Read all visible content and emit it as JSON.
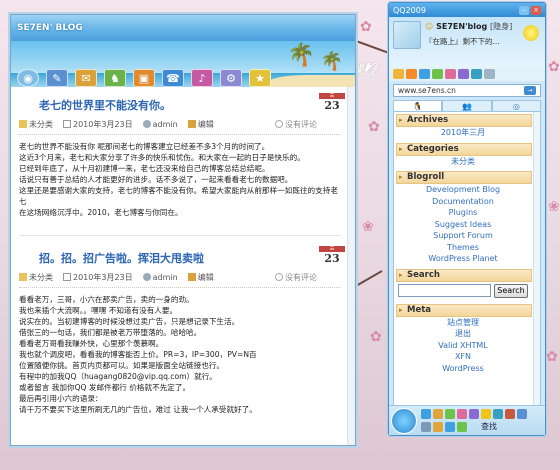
{
  "colors": {
    "blog_title_blue": "#2d66b3",
    "link_blue": "#2f6fbf",
    "qq_frame": "#4d8fc5",
    "widget_header": "#f2d59a",
    "date_red": "#c2463f"
  },
  "blog_window": {
    "title": "SE7EN' BLOG",
    "toolbar_icons": [
      "home-icon",
      "pen-icon",
      "mail-icon",
      "game-icon",
      "picture-icon",
      "chat-icon",
      "music-icon",
      "settings-icon",
      "star-icon"
    ],
    "posts": [
      {
        "title": "老七的世界里不能没有你。",
        "day": "23",
        "category": "未分类",
        "date": "2010年3月23日",
        "author": "admin",
        "edit": "编辑",
        "comments": "没有评论",
        "lines": [
          "老七的世界不能没有你  呢那间老七的博客建立已经差不多3个月的时间了。",
          "这近3个月来，老七和大家分享了许多的快乐和忧伤。和大家在一起的日子是快乐的。",
          "已经到年底了，从十月初建博一来，老七还没来给自己的博客总结总结呢。",
          "话说只有善于总结的人才能更好的进步。话不多说了，一起来看看老七的数据吧。",
          "这里还是要感谢大家的支持，老七的博客不能没有你。希望大家能向从前那样一如既往的支持老",
          "七",
          "在这场网络沉浮中。2010，老七博客与你同在。"
        ]
      },
      {
        "title": "招。招。招广告啦。挥泪大甩卖啦",
        "day": "23",
        "category": "未分类",
        "date": "2010年3月23日",
        "author": "admin",
        "edit": "编辑",
        "comments": "没有评论",
        "lines": [
          "看看老万，三哥，小六在那卖广告，卖的一身的劲。",
          "我也来插个大流啊。。嘿嘿  不知道有没有人要。",
          "说实在的。当初建博客的时候没想过卖广告，只是想记录下生活。",
          "借张三的一句话，我们都是被老万带堕落的。哈哈哈。",
          "看看老万哥看我赚外快，心里那个羡慕啊。",
          "我也就个调皮吧，看看我的博客能否上价。PR=3，IP=300，PV=N百",
          "位置随便你挑。首页内页都可以。如果是版面全站链接也行。",
          "有程中的加我QQ（huagang0820@vip.qq.com）就行。",
          "或者留言  我加你QQ  发邮件都行  价格就不先定了。",
          "最后再引用小六的语录：",
          "请千万不要买下这里所刷无几的广告位，难过  让我一个人承受就好了。"
        ]
      }
    ]
  },
  "qq_panel": {
    "title": "QQ2009",
    "nickname": "SE7EN'blog",
    "status": "[隐身]",
    "signature": "『在路上』剩不下的...",
    "address": "www.se7ens.cn",
    "tabs": [
      "qq-penguin-icon",
      "people-icon",
      "globe-icon"
    ],
    "widgets": {
      "archives": {
        "title": "Archives",
        "items": [
          "2010年三月"
        ]
      },
      "categories": {
        "title": "Categories",
        "items": [
          "未分类"
        ]
      },
      "blogroll": {
        "title": "Blogroll",
        "items": [
          "Development Blog",
          "Documentation",
          "Plugins",
          "Suggest Ideas",
          "Support Forum",
          "Themes",
          "WordPress Planet"
        ]
      },
      "search": {
        "title": "Search",
        "button": "Search",
        "value": ""
      },
      "meta": {
        "title": "Meta",
        "items": [
          "站点管理",
          "退出",
          "Valid XHTML",
          "XFN",
          "WordPress"
        ]
      }
    },
    "find_label": "查找"
  }
}
